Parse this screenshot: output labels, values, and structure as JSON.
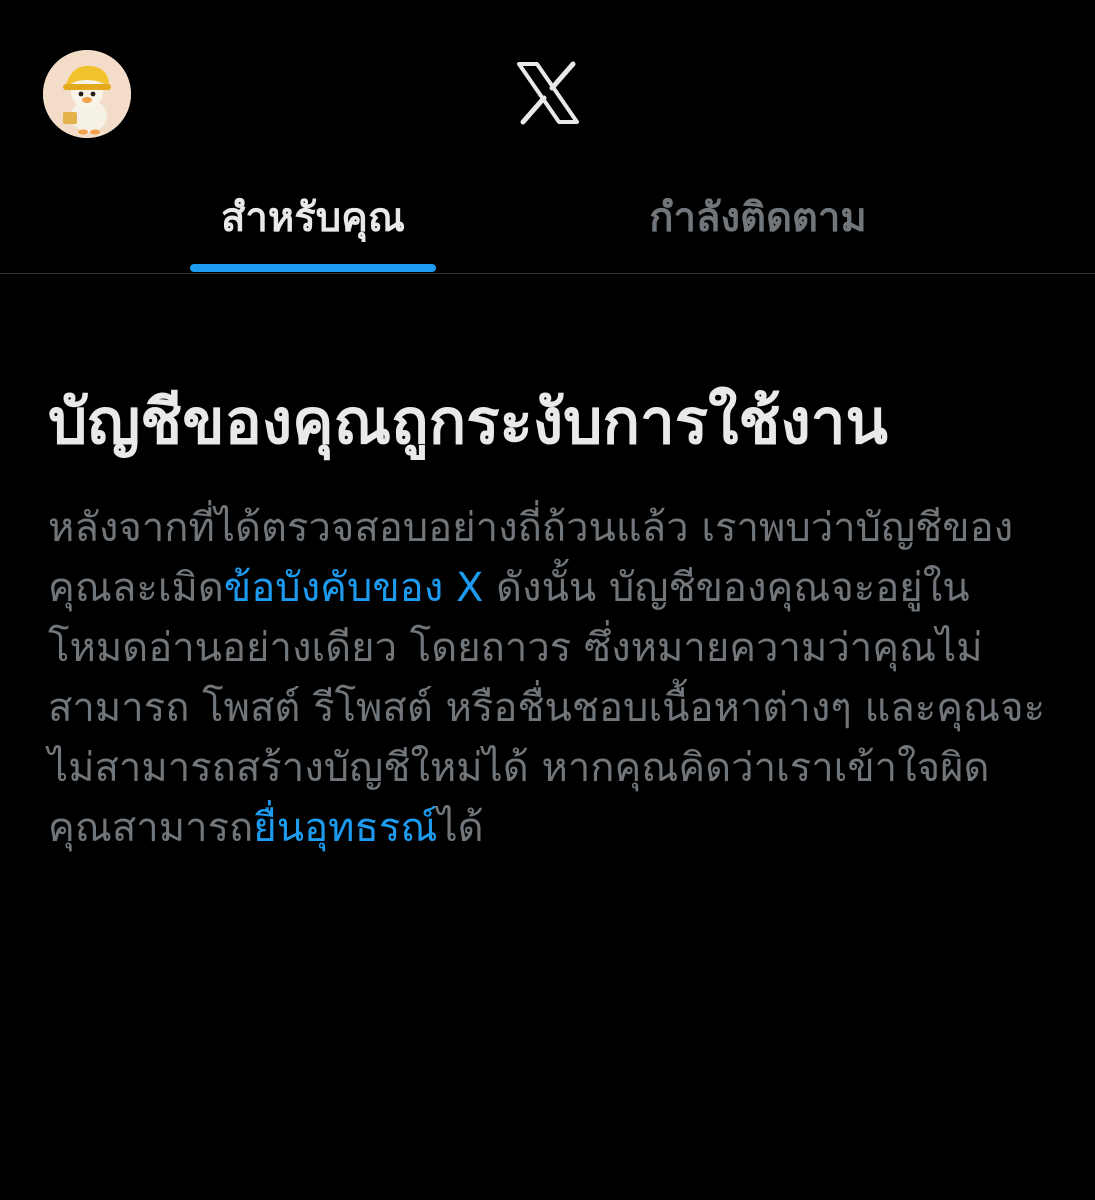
{
  "header": {
    "avatar_label": "avatar",
    "logo_name": "x-logo-icon"
  },
  "tabs": [
    {
      "label": "สำหรับคุณ",
      "active": true
    },
    {
      "label": "กำลังติดตาม",
      "active": false
    }
  ],
  "notice": {
    "title": "บัญชีของคุณถูกระงับการใช้งาน",
    "body_part1": "หลังจากที่ได้ตรวจสอบอย่างถี่ถ้วนแล้ว เราพบว่าบัญชีของคุณละเมิด",
    "rules_link": "ข้อบังคับของ X",
    "body_part2": " ดังนั้น บัญชีของคุณจะอยู่ใน โหมดอ่านอย่างเดียว โดยถาวร ซึ่งหมายความว่าคุณไม่สามารถ โพสต์ รีโพสต์ หรือชื่นชอบเนื้อหาต่างๆ และคุณจะไม่สามารถสร้างบัญชีใหม่ได้ หากคุณคิดว่าเราเข้าใจผิด คุณสามารถ",
    "appeal_link": "ยื่นอุทธรณ์",
    "body_part3": "ได้"
  },
  "colors": {
    "background": "#000000",
    "text_primary": "#e7e9ea",
    "text_secondary": "#71767b",
    "accent": "#1d9bf0",
    "divider": "#2f3336"
  }
}
